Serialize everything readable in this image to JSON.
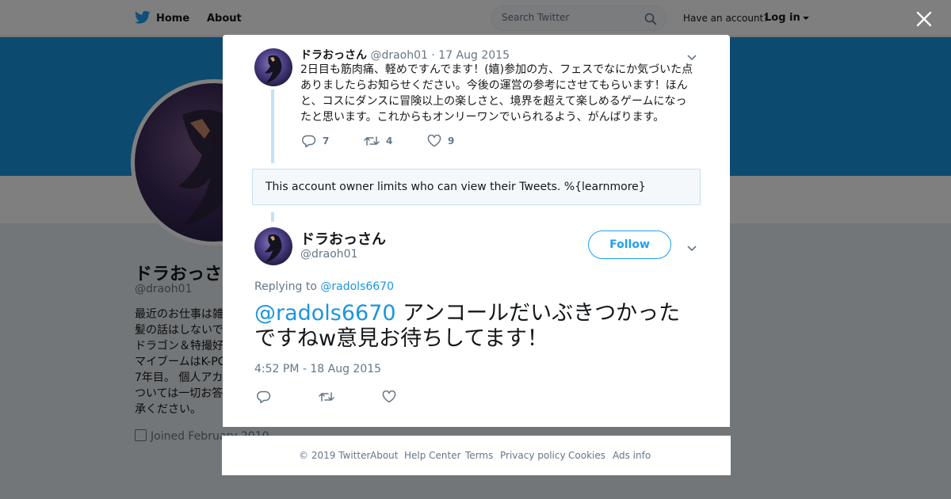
{
  "nav": {
    "home_label": "Home",
    "about_label": "About",
    "search_placeholder": "Search Twitter",
    "have_account": "Have an account?",
    "login_label": "Log in"
  },
  "profile": {
    "name": "ドラおっさ",
    "handle": "@draoh01",
    "bio_lines": [
      "最近のお仕事は雑",
      "髪の話はしないで",
      "ドラゴン＆特撮好",
      "マイブームはK-PC",
      "7年目。 個人アカ",
      "ついては一切お答",
      "承ください。"
    ],
    "joined": "Joined February 2010"
  },
  "tweet1": {
    "name": "ドラおっさん",
    "handle": "@draoh01",
    "separator": "·",
    "date": "17 Aug 2015",
    "text": "2日目も筋肉痛、軽めですんでます！(嬉)参加の方、フェスでなにか気づいた点ありましたらお知らせください。今後の運営の参考にさせてもらいます！ほんと、コスにダンスに冒険以上の楽しさと、境界を超えて楽しめるゲームになったと思います。これからもオンリーワンでいられるよう、がんばります。",
    "replies": "7",
    "retweets": "4",
    "likes": "9"
  },
  "notice": "This account owner limits who can view their Tweets. %{learnmore}",
  "tweet2": {
    "name": "ドラおっさん",
    "handle": "@draoh01",
    "follow_label": "Follow",
    "replying_prefix": "Replying to",
    "replying_to": "@radols6670",
    "mention": "@radols6670",
    "text": " アンコールだいぶきつかったですねw意見お待ちしてます！",
    "timestamp": "4:52 PM - 18 Aug 2015"
  },
  "footer": {
    "copyright": "© 2019 Twitter",
    "about": "About",
    "help": "Help Center",
    "terms": "Terms",
    "privacy": "Privacy policy",
    "cookies": "Cookies",
    "ads": "Ads info"
  },
  "colors": {
    "brand_blue": "#1da1f2",
    "link_blue": "#1b95e0",
    "banner": "#1b95e0",
    "thread_line": "#c4e0f5",
    "muted_text": "#657786"
  },
  "icons": [
    "twitter-bird-icon",
    "search-icon",
    "caret-down-icon",
    "close-icon",
    "reply-icon",
    "retweet-icon",
    "like-icon",
    "calendar-icon"
  ]
}
